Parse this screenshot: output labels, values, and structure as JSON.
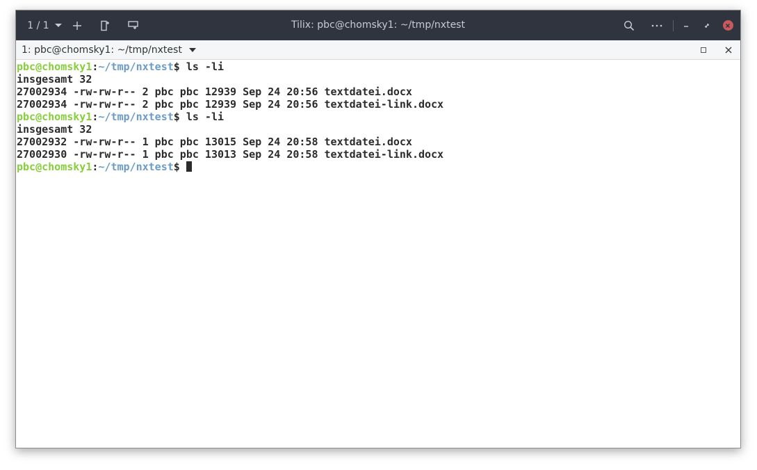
{
  "headerbar": {
    "session_counter": "1 / 1",
    "title": "Tilix: pbc@chomsky1: ~/tmp/nxtest",
    "icons": {
      "add": "plus-icon",
      "split_right": "split-right-icon",
      "split_down": "split-down-icon",
      "search": "search-icon",
      "menu": "more-horizontal-icon",
      "minimize": "minimize-icon",
      "maximize": "maximize-icon",
      "close": "close-icon"
    },
    "colors": {
      "background": "#2f343f",
      "close": "#cc575d"
    }
  },
  "terminal_bar": {
    "title": "1: pbc@chomsky1: ~/tmp/nxtest"
  },
  "terminal": {
    "prompt": {
      "user": "pbc@chomsky1",
      "colon": ":",
      "path": "~/tmp/nxtest",
      "symbol": "$"
    },
    "commands": [
      {
        "command": " ls -li",
        "output": [
          "insgesamt 32",
          "27002934 -rw-rw-r-- 2 pbc pbc 12939 Sep 24 20:56 textdatei.docx",
          "27002934 -rw-rw-r-- 2 pbc pbc 12939 Sep 24 20:56 textdatei-link.docx"
        ]
      },
      {
        "command": " ls -li",
        "output": [
          "insgesamt 32",
          "27002932 -rw-rw-r-- 1 pbc pbc 13015 Sep 24 20:58 textdatei.docx",
          "27002930 -rw-rw-r-- 1 pbc pbc 13013 Sep 24 20:58 textdatei-link.docx"
        ]
      }
    ],
    "colors": {
      "user": "#86cf3b",
      "path": "#6c9ccc",
      "text": "#2b2b2b"
    }
  }
}
